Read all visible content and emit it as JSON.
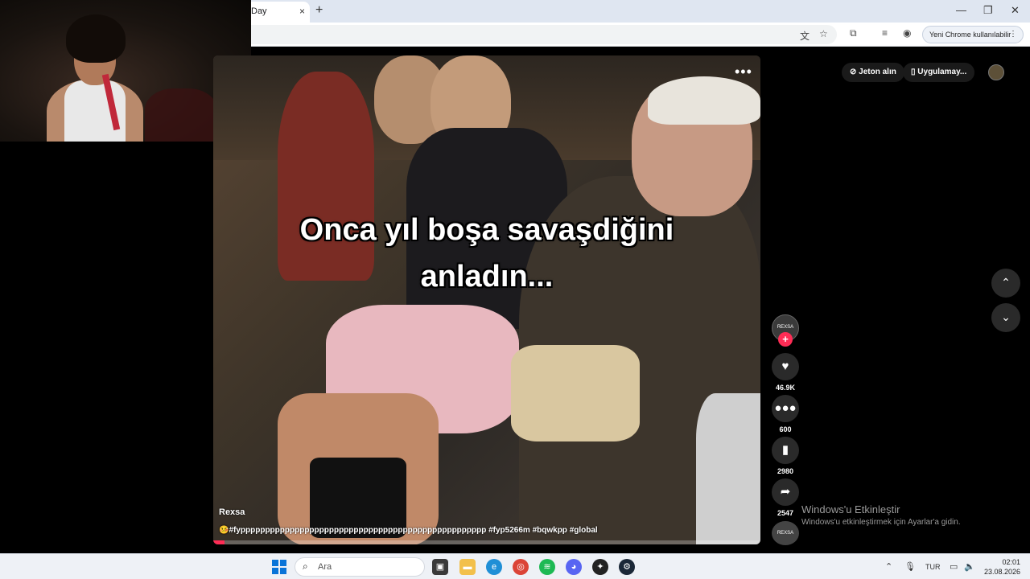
{
  "browser": {
    "tab_title": "Day",
    "tab_close": "×",
    "new_tab": "+",
    "window_minimize": "—",
    "window_maximize": "❐",
    "window_close": "✕",
    "update_button": "Yeni Chrome kullanılabilir",
    "update_menu": "⋮"
  },
  "tiktok": {
    "coins_button": "Jeton alın",
    "app_button": "Uygulamay...",
    "video_more": "•••",
    "caption_line1": "Onca yıl boşa savaşdiğini",
    "caption_line2": "anladın...",
    "creator_name": "Rexsa",
    "hashtags": "🤒#fypppppppppppppppppppppppppppppppppppppppppppppppppp #fyp5266m #bqwkpp #global",
    "progress_fraction": 0.02,
    "avatar_text": "REXSA",
    "follow_label": "+",
    "likes": "46.9K",
    "comments": "600",
    "saves": "2980",
    "shares": "2547",
    "nav_up": "⌃",
    "nav_down": "⌄",
    "accent_color": "#fe2c55"
  },
  "watermark": {
    "title": "Windows'u Etkinleştir",
    "subtitle": "Windows'u etkinleştirmek için Ayarlar'a gidin."
  },
  "taskbar": {
    "search_placeholder": "Ara",
    "language": "TUR",
    "time": "02:01",
    "date": "23.08.2026"
  }
}
